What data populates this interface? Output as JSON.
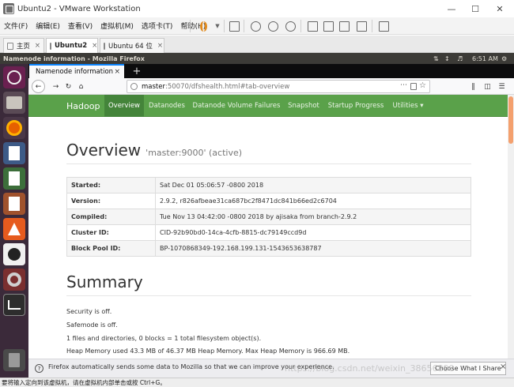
{
  "vmware": {
    "title": "Ubuntu2 - VMware Workstation",
    "menu": [
      "文件(F)",
      "编辑(E)",
      "查看(V)",
      "虚拟机(M)",
      "选项卡(T)",
      "帮助(H)"
    ],
    "tabs": [
      {
        "label": "主页"
      },
      {
        "label": "Ubuntu2"
      },
      {
        "label": "Ubuntu 64 位"
      }
    ],
    "status_text": "要将输入定向到该虚拟机，请在虚拟机内部单击或按 Ctrl+G。"
  },
  "ubuntu": {
    "window_title": "Namenode information - Mozilla Firefox",
    "time": "6:51 AM"
  },
  "firefox": {
    "tab_title": "Namenode information",
    "url_host": "master",
    "url_rest": ":50070/dfshealth.html#tab-overview"
  },
  "hadoop": {
    "brand": "Hadoop",
    "nav": [
      "Overview",
      "Datanodes",
      "Datanode Volume Failures",
      "Snapshot",
      "Startup Progress",
      "Utilities ▾"
    ],
    "overview": {
      "title": "Overview",
      "subtitle": "'master:9000' (active)",
      "rows": [
        {
          "key": "Started:",
          "value": "Sat Dec 01 05:06:57 -0800 2018"
        },
        {
          "key": "Version:",
          "value": "2.9.2, r826afbeae31ca687bc2f8471dc841b66ed2c6704"
        },
        {
          "key": "Compiled:",
          "value": "Tue Nov 13 04:42:00 -0800 2018 by ajisaka from branch-2.9.2"
        },
        {
          "key": "Cluster ID:",
          "value": "CID-92b90bd0-14ca-4cfb-8815-dc79149ccd9d"
        },
        {
          "key": "Block Pool ID:",
          "value": "BP-1070868349-192.168.199.131-1543653638787"
        }
      ]
    },
    "summary": {
      "title": "Summary",
      "lines": [
        "Security is off.",
        "Safemode is off.",
        "1 files and directories, 0 blocks = 1 total filesystem object(s).",
        "Heap Memory used 43.3 MB of 46.37 MB Heap Memory. Max Heap Memory is 966.69 MB."
      ]
    }
  },
  "notification": {
    "message": "Firefox automatically sends some data to Mozilla so that we can improve your experience.",
    "button": "Choose What I Share"
  },
  "watermark": "https://blog.csdn.net/weixin_38656890"
}
